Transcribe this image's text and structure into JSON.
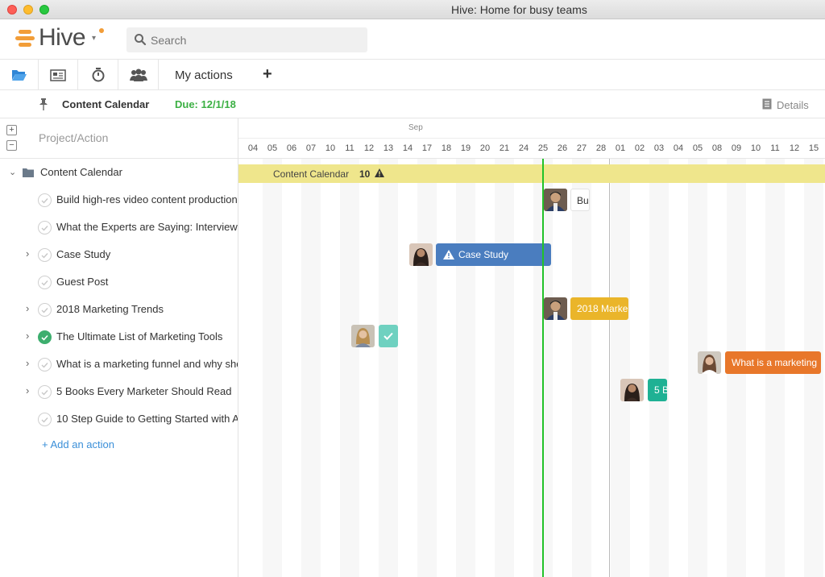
{
  "window": {
    "title": "Hive: Home for busy teams"
  },
  "brand": {
    "name": "Hive",
    "accent": "#f29d38"
  },
  "search": {
    "placeholder": "Search"
  },
  "nav": {
    "icons": [
      "folder-icon",
      "newspaper-icon",
      "stopwatch-icon",
      "team-icon"
    ],
    "my_actions": "My actions",
    "add": "+"
  },
  "project": {
    "title": "Content Calendar",
    "due": "Due: 12/1/18",
    "details": "Details"
  },
  "left": {
    "column_header": "Project/Action",
    "expand": "+",
    "collapse": "−",
    "rows": [
      {
        "label": "Content Calendar",
        "type": "project"
      },
      {
        "label": "Build high-res video content production",
        "type": "action"
      },
      {
        "label": "What the Experts are Saying: Interview",
        "type": "action"
      },
      {
        "label": "Case Study",
        "type": "action"
      },
      {
        "label": "Guest Post",
        "type": "action"
      },
      {
        "label": "2018 Marketing Trends",
        "type": "action"
      },
      {
        "label": "The Ultimate List of Marketing Tools",
        "type": "action",
        "done": true
      },
      {
        "label": "What is a marketing funnel and why sho",
        "type": "action"
      },
      {
        "label": "5 Books Every Marketer Should Read",
        "type": "action"
      },
      {
        "label": "10 Step Guide to Getting Started with A",
        "type": "action"
      }
    ],
    "add_action": "+ Add an action"
  },
  "timeline": {
    "month_label": "Sep",
    "days": [
      "04",
      "05",
      "06",
      "07",
      "10",
      "11",
      "12",
      "13",
      "14",
      "17",
      "18",
      "19",
      "20",
      "21",
      "24",
      "25",
      "26",
      "27",
      "28",
      "01",
      "02",
      "03",
      "04",
      "05",
      "08",
      "09",
      "10",
      "11",
      "12",
      "15"
    ],
    "band": {
      "label": "Content Calendar",
      "count": "10"
    },
    "bars": [
      {
        "label": "Bu",
        "color": "#ffffff"
      },
      {
        "label": "Case Study",
        "color": "#4a7dbf"
      },
      {
        "label": "2018 Marke",
        "color": "#eab52a"
      },
      {
        "label": "What is a marketing",
        "color": "#e8772a"
      },
      {
        "label": "5 B",
        "color": "#1fb194"
      }
    ],
    "today_color": "#22c229"
  }
}
